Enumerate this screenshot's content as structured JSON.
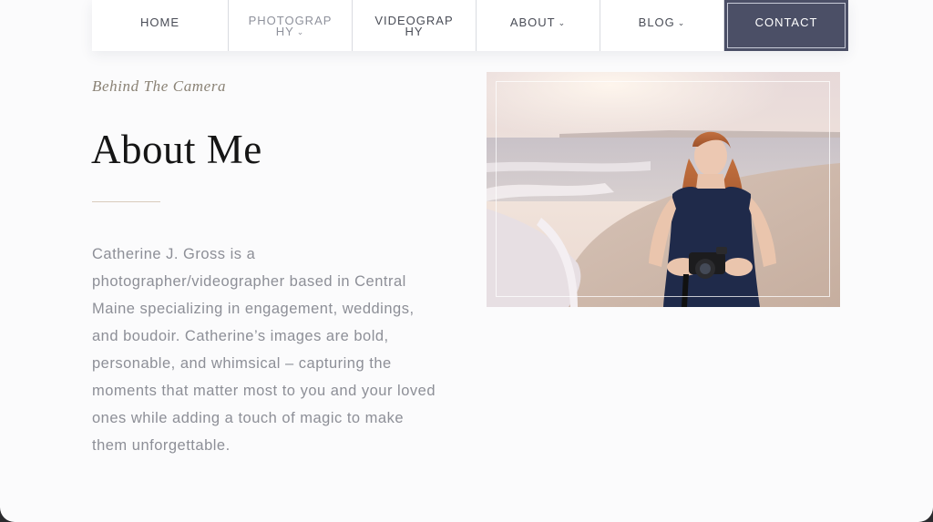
{
  "nav": {
    "items": [
      {
        "label": "HOME",
        "dropdown": false
      },
      {
        "label": "PHOTOGRAPHY",
        "dropdown": true
      },
      {
        "label": "VIDEOGRAPHY",
        "dropdown": false
      },
      {
        "label": "ABOUT",
        "dropdown": true
      },
      {
        "label": "BLOG",
        "dropdown": true
      }
    ],
    "contact_label": "CONTACT",
    "contact_bg": "#4b4f66"
  },
  "about": {
    "eyebrow": "Behind The Camera",
    "title": "About Me",
    "bio": "Catherine J. Gross is a photographer/videographer based in Central Maine specializing in engagement, weddings, and boudoir. Catherine’s images are bold, personable, and whimsical – capturing the moments that matter most to you and your loved ones while adding a touch of magic to make them unforgettable."
  },
  "photo": {
    "subject": "woman-with-camera-on-beach"
  },
  "icons": {
    "dropdown": "chevron-down-icon"
  }
}
